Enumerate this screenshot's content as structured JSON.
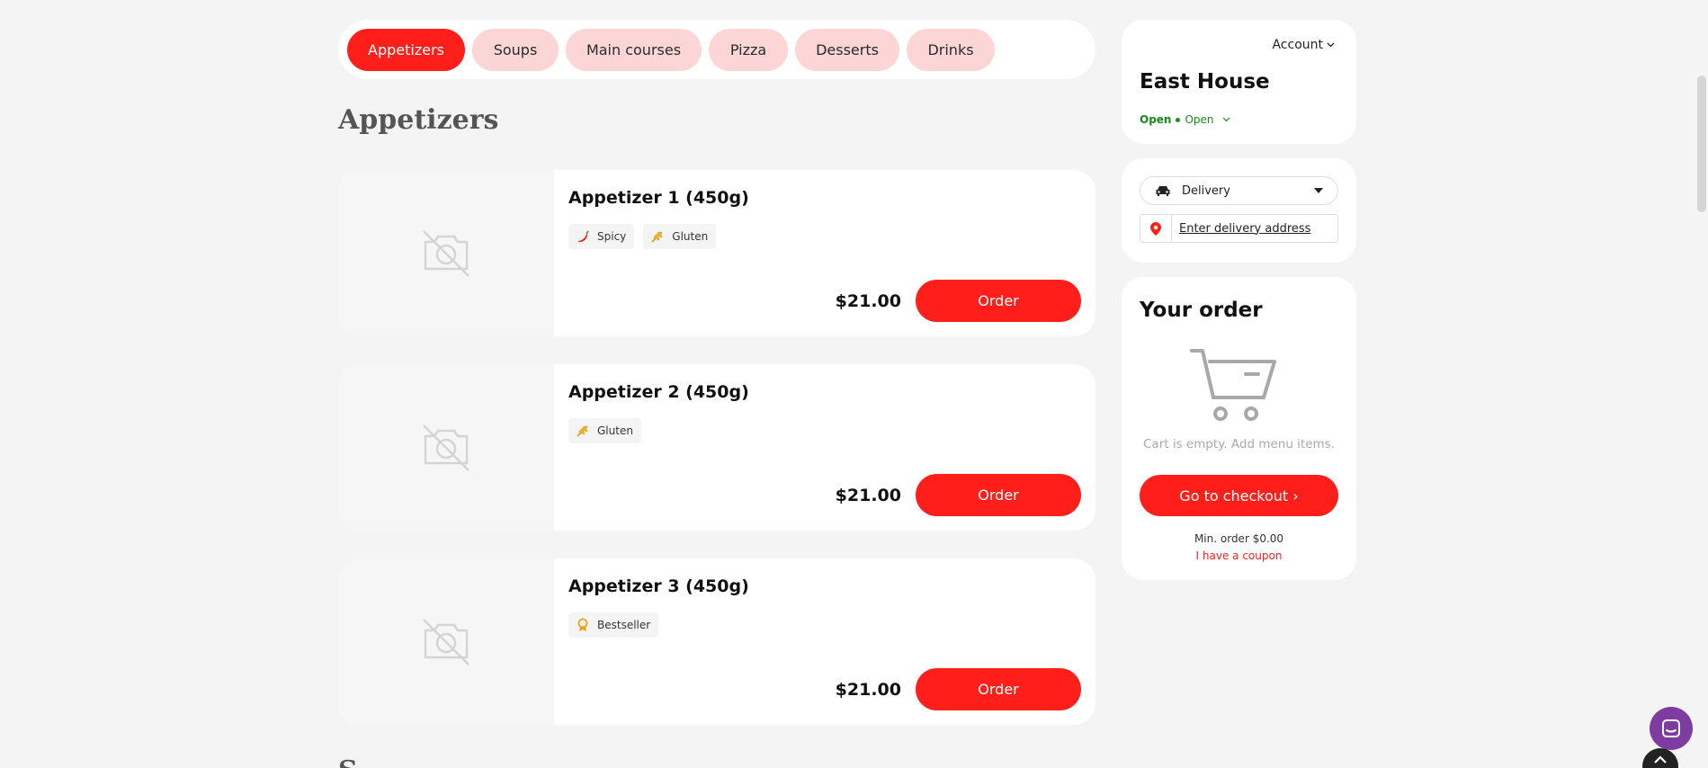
{
  "categories": [
    {
      "label": "Appetizers",
      "active": true
    },
    {
      "label": "Soups",
      "active": false
    },
    {
      "label": "Main courses",
      "active": false
    },
    {
      "label": "Pizza",
      "active": false
    },
    {
      "label": "Desserts",
      "active": false
    },
    {
      "label": "Drinks",
      "active": false
    }
  ],
  "section_title": "Appetizers",
  "next_section_partial": "S",
  "products": [
    {
      "name": "Appetizer 1 (450g)",
      "tags": [
        {
          "icon": "chili-icon",
          "label": "Spicy"
        },
        {
          "icon": "wheat-icon",
          "label": "Gluten"
        }
      ],
      "price": "$21.00",
      "order_label": "Order"
    },
    {
      "name": "Appetizer 2 (450g)",
      "tags": [
        {
          "icon": "wheat-icon",
          "label": "Gluten"
        }
      ],
      "price": "$21.00",
      "order_label": "Order"
    },
    {
      "name": "Appetizer 3 (450g)",
      "tags": [
        {
          "icon": "award-icon",
          "label": "Bestseller"
        }
      ],
      "price": "$21.00",
      "order_label": "Order"
    }
  ],
  "store": {
    "account_label": "Account",
    "name": "East House",
    "status_bold": "Open",
    "status_text": "Open"
  },
  "delivery": {
    "mode": "Delivery",
    "address_label": "Enter delivery address"
  },
  "order": {
    "title": "Your order",
    "empty_text": "Cart is empty. Add menu items.",
    "checkout_label": "Go to checkout ›",
    "min_order": "Min. order $0.00",
    "coupon_label": "I have a coupon"
  },
  "colors": {
    "accent": "#ff1f1a",
    "pill": "#fcd6d6",
    "open": "#1a8a1a",
    "chat": "#7e3ca0"
  }
}
